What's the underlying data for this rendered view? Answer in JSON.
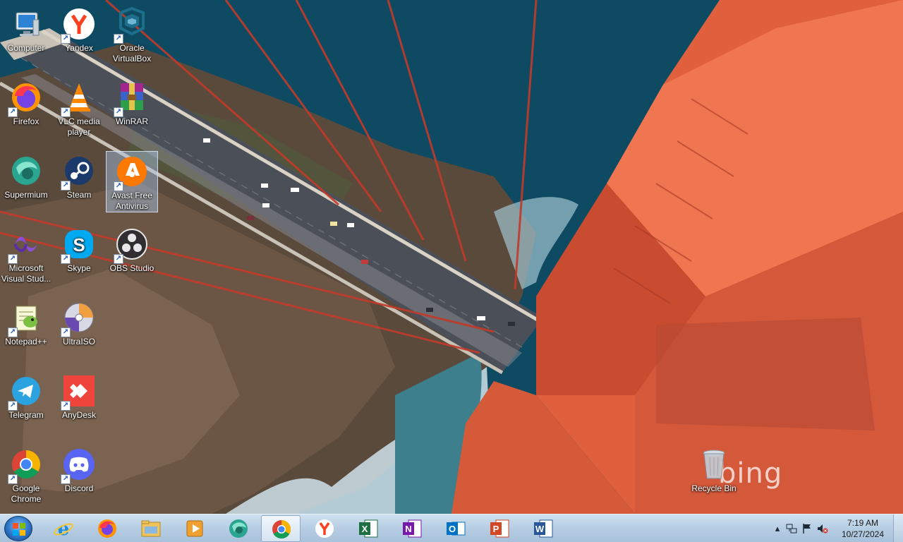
{
  "desktop": {
    "icons": [
      {
        "label": "Computer",
        "icon": "computer-icon"
      },
      {
        "label": "Yandex",
        "icon": "yandex-icon"
      },
      {
        "label": "Oracle VirtualBox",
        "icon": "virtualbox-icon"
      },
      {
        "label": "Firefox",
        "icon": "firefox-icon"
      },
      {
        "label": "VLC media player",
        "icon": "vlc-icon"
      },
      {
        "label": "WinRAR",
        "icon": "winrar-icon"
      },
      {
        "label": "Supermium",
        "icon": "supermium-icon"
      },
      {
        "label": "Steam",
        "icon": "steam-icon"
      },
      {
        "label": "Avast Free Antivirus",
        "icon": "avast-icon"
      },
      {
        "label": "Microsoft Visual Stud...",
        "icon": "visual-studio-icon"
      },
      {
        "label": "Skype",
        "icon": "skype-icon"
      },
      {
        "label": "OBS Studio",
        "icon": "obs-icon"
      },
      {
        "label": "Notepad++",
        "icon": "notepadpp-icon"
      },
      {
        "label": "UltraISO",
        "icon": "ultraiso-icon"
      },
      {
        "label": "Telegram",
        "icon": "telegram-icon"
      },
      {
        "label": "AnyDesk",
        "icon": "anydesk-icon"
      },
      {
        "label": "Google Chrome",
        "icon": "chrome-icon"
      },
      {
        "label": "Discord",
        "icon": "discord-icon"
      },
      {
        "label": "Recycle Bin",
        "icon": "recycle-bin-icon"
      }
    ],
    "selected_icon": "Avast Free Antivirus",
    "wallpaper_watermark": "bing"
  },
  "taskbar": {
    "start_icon": "windows-start-icon",
    "pinned": [
      {
        "app": "Internet Explorer",
        "icon": "internet-explorer-icon"
      },
      {
        "app": "Firefox",
        "icon": "firefox-icon"
      },
      {
        "app": "File Explorer",
        "icon": "file-explorer-icon"
      },
      {
        "app": "Media Player",
        "icon": "media-player-icon"
      },
      {
        "app": "Supermium",
        "icon": "supermium-icon"
      },
      {
        "app": "Google Chrome",
        "icon": "chrome-icon",
        "active": true
      },
      {
        "app": "Yandex",
        "icon": "yandex-icon"
      },
      {
        "app": "Excel",
        "icon": "excel-icon"
      },
      {
        "app": "OneNote",
        "icon": "onenote-icon"
      },
      {
        "app": "Outlook",
        "icon": "outlook-icon"
      },
      {
        "app": "PowerPoint",
        "icon": "powerpoint-icon"
      },
      {
        "app": "Word",
        "icon": "word-icon"
      }
    ],
    "tray": {
      "time": "7:19 AM",
      "date": "10/27/2024"
    }
  },
  "colors": {
    "taskbar": "#b6cde3",
    "selection": "#aac8eb",
    "bridge_orange": "#e8623f"
  }
}
